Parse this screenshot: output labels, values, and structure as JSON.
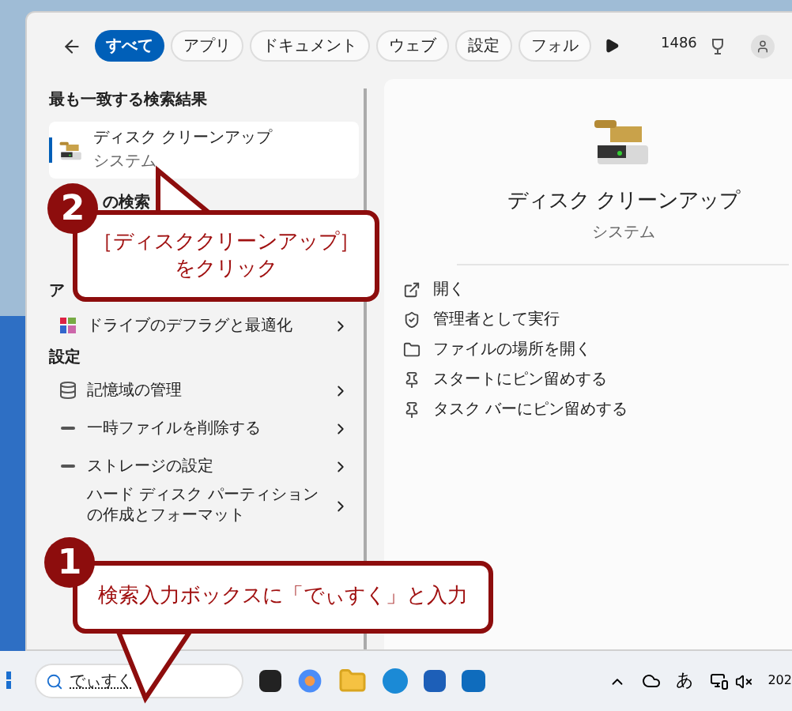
{
  "search_window": {
    "tabs": [
      {
        "label": "すべて",
        "selected": true
      },
      {
        "label": "アプリ",
        "selected": false
      },
      {
        "label": "ドキュメント",
        "selected": false
      },
      {
        "label": "ウェブ",
        "selected": false
      },
      {
        "label": "設定",
        "selected": false
      },
      {
        "label": "フォル",
        "selected": false
      }
    ],
    "points": "1486",
    "best_match": {
      "heading": "最も一致する検索結果",
      "title": "ディスク クリーンアップ",
      "subtitle": "システム",
      "selected": true
    },
    "partial_headings": [
      "の検索",
      "ア"
    ],
    "app_item": {
      "label": "ドライブのデフラグと最適化"
    },
    "settings": {
      "heading": "設定",
      "items": [
        {
          "kind": "storage",
          "label": "記憶域の管理"
        },
        {
          "kind": "drive",
          "label": "一時ファイルを削除する"
        },
        {
          "kind": "drive",
          "label": "ストレージの設定"
        },
        {
          "kind": "blank",
          "label": "ハード ディスク パーティションの作成とフォーマット"
        }
      ]
    },
    "detail": {
      "title": "ディスク クリーンアップ",
      "subtitle": "システム",
      "actions": [
        {
          "kind": "open",
          "label": "開く"
        },
        {
          "kind": "admin",
          "label": "管理者として実行"
        },
        {
          "kind": "folder",
          "label": "ファイルの場所を開く"
        },
        {
          "kind": "pin",
          "label": "スタートにピン留めする"
        },
        {
          "kind": "pin",
          "label": "タスク バーにピン留めする"
        }
      ]
    }
  },
  "taskbar": {
    "search_value": "でぃすく",
    "ime": "あ",
    "clock": "202"
  },
  "callouts": [
    {
      "number": "2",
      "lines": [
        "［ディスククリーンアップ］",
        "をクリック"
      ]
    },
    {
      "number": "1",
      "lines": [
        "検索入力ボックスに「でぃすく」と入力"
      ]
    }
  ]
}
